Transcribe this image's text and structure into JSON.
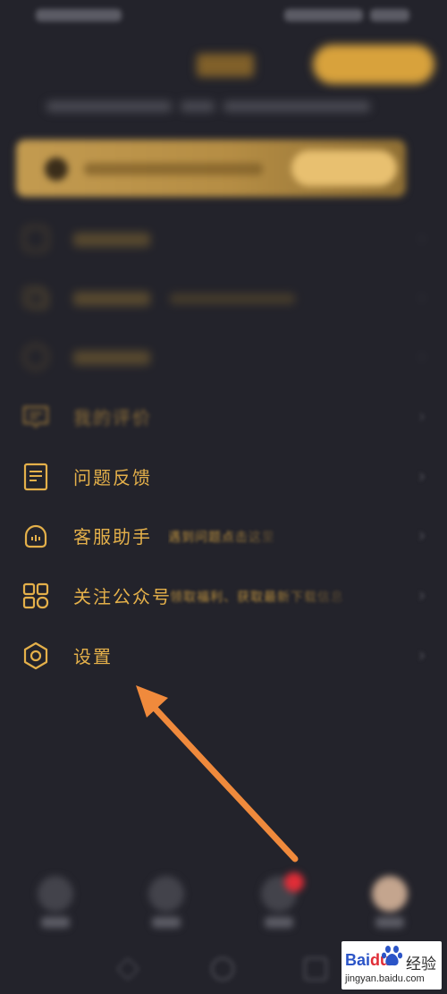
{
  "menu": {
    "items": [
      {
        "label": "我的评价",
        "icon": "comment-icon"
      },
      {
        "label": "问题反馈",
        "icon": "feedback-document-icon"
      },
      {
        "label": "客服助手",
        "icon": "customer-service-headset-icon",
        "desc": "遇到问题点击这里"
      },
      {
        "label": "关注公众号",
        "icon": "official-account-grid-icon",
        "desc": "领取福利、获取最新下载信息"
      },
      {
        "label": "设置",
        "icon": "settings-gear-icon"
      }
    ]
  },
  "annotation": {
    "arrow_color": "#f08a3c",
    "target": "设置"
  },
  "tabbar": {
    "active_badge_color": "#e02d37"
  },
  "watermark": {
    "brand_bai": "Bai",
    "brand_du": "du",
    "brand_cn": "经验",
    "url": "jingyan.baidu.com"
  },
  "colors": {
    "background": "#23232b",
    "accent": "#e9b54a"
  }
}
